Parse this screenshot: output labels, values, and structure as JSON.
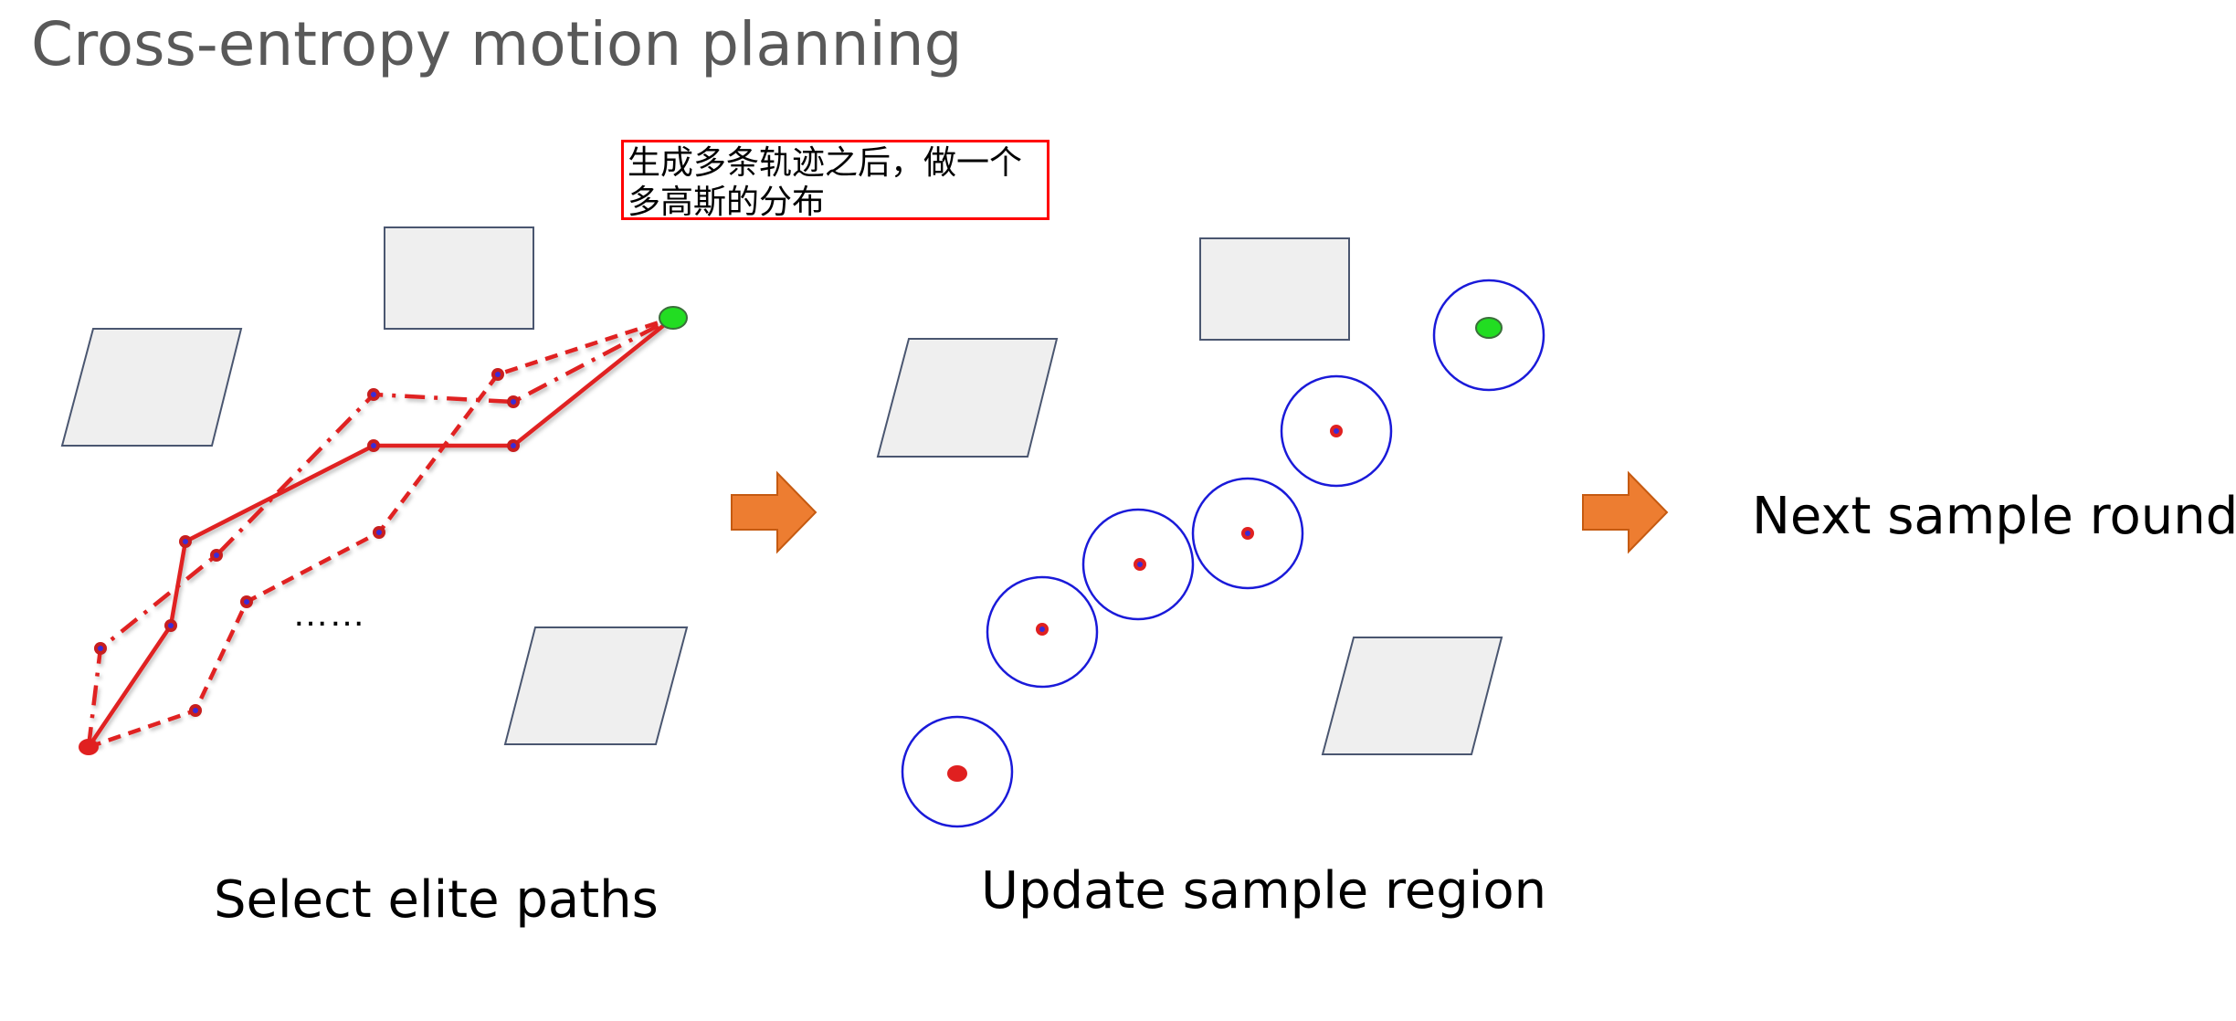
{
  "title": "Cross-entropy motion planning",
  "note": "生成多条轨迹之后，做一个多高斯的分布",
  "ellipsis": "……",
  "captions": {
    "select": "Select elite paths",
    "update": "Update sample region",
    "next": "Next sample round"
  },
  "colors": {
    "path": "#e02020",
    "start": "#e02020",
    "goal": "#22dd22",
    "waypoint_inner": "#3b2bd6",
    "circle": "#1a1ad9",
    "obstacle_fill": "#efefef",
    "obstacle_stroke": "#4a5670",
    "arrow_fill": "#ed7d31",
    "arrow_stroke": "#c55a11",
    "note_border": "#ff0000"
  }
}
